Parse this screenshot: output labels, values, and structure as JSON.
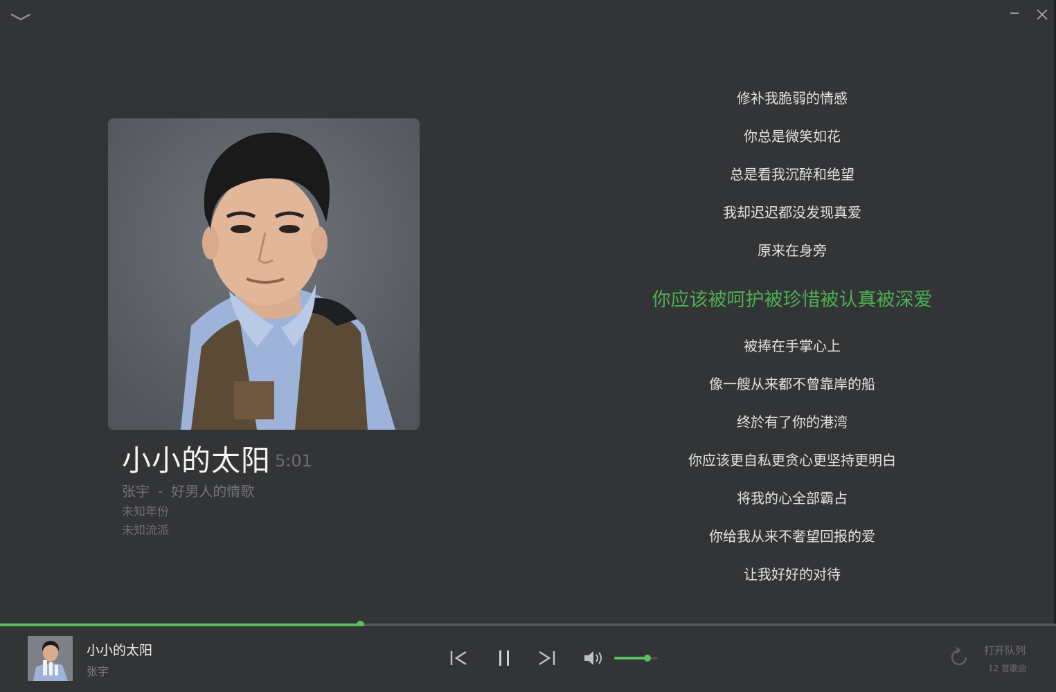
{
  "song": {
    "title": "小小的太阳",
    "duration": "5:01",
    "artist": "张宇",
    "separator": "-",
    "album": "好男人的情歌",
    "year": "未知年份",
    "genre": "未知流派"
  },
  "lyrics": [
    {
      "text": "修补我脆弱的情感",
      "active": false
    },
    {
      "text": "你总是微笑如花",
      "active": false
    },
    {
      "text": "总是看我沉醉和绝望",
      "active": false
    },
    {
      "text": "我却迟迟都没发现真爱",
      "active": false
    },
    {
      "text": "原来在身旁",
      "active": false
    },
    {
      "text": "你应该被呵护被珍惜被认真被深爱",
      "active": true
    },
    {
      "text": "被捧在手掌心上",
      "active": false
    },
    {
      "text": "像一艘从来都不曾靠岸的船",
      "active": false
    },
    {
      "text": "终於有了你的港湾",
      "active": false
    },
    {
      "text": "你应该更自私更贪心更坚持更明白",
      "active": false
    },
    {
      "text": "将我的心全部霸占",
      "active": false
    },
    {
      "text": "你给我从来不奢望回报的爱",
      "active": false
    },
    {
      "text": "让我好好的对待",
      "active": false
    }
  ],
  "player": {
    "progress_fraction": 0.341,
    "volume_fraction": 0.76,
    "now_playing_title": "小小的太阳",
    "now_playing_artist": "张宇",
    "queue_label": "打开队列",
    "queue_count": "12 首歌曲"
  },
  "colors": {
    "accent": "#5bbf5f",
    "active_lyric": "#4caf50",
    "background": "#333436"
  },
  "icons": {
    "collapse": "chevron-down-icon",
    "minimize": "minimize-icon",
    "close": "close-icon",
    "previous": "previous-track-icon",
    "pause": "pause-icon",
    "next": "next-track-icon",
    "volume": "volume-icon",
    "repeat": "repeat-icon"
  }
}
